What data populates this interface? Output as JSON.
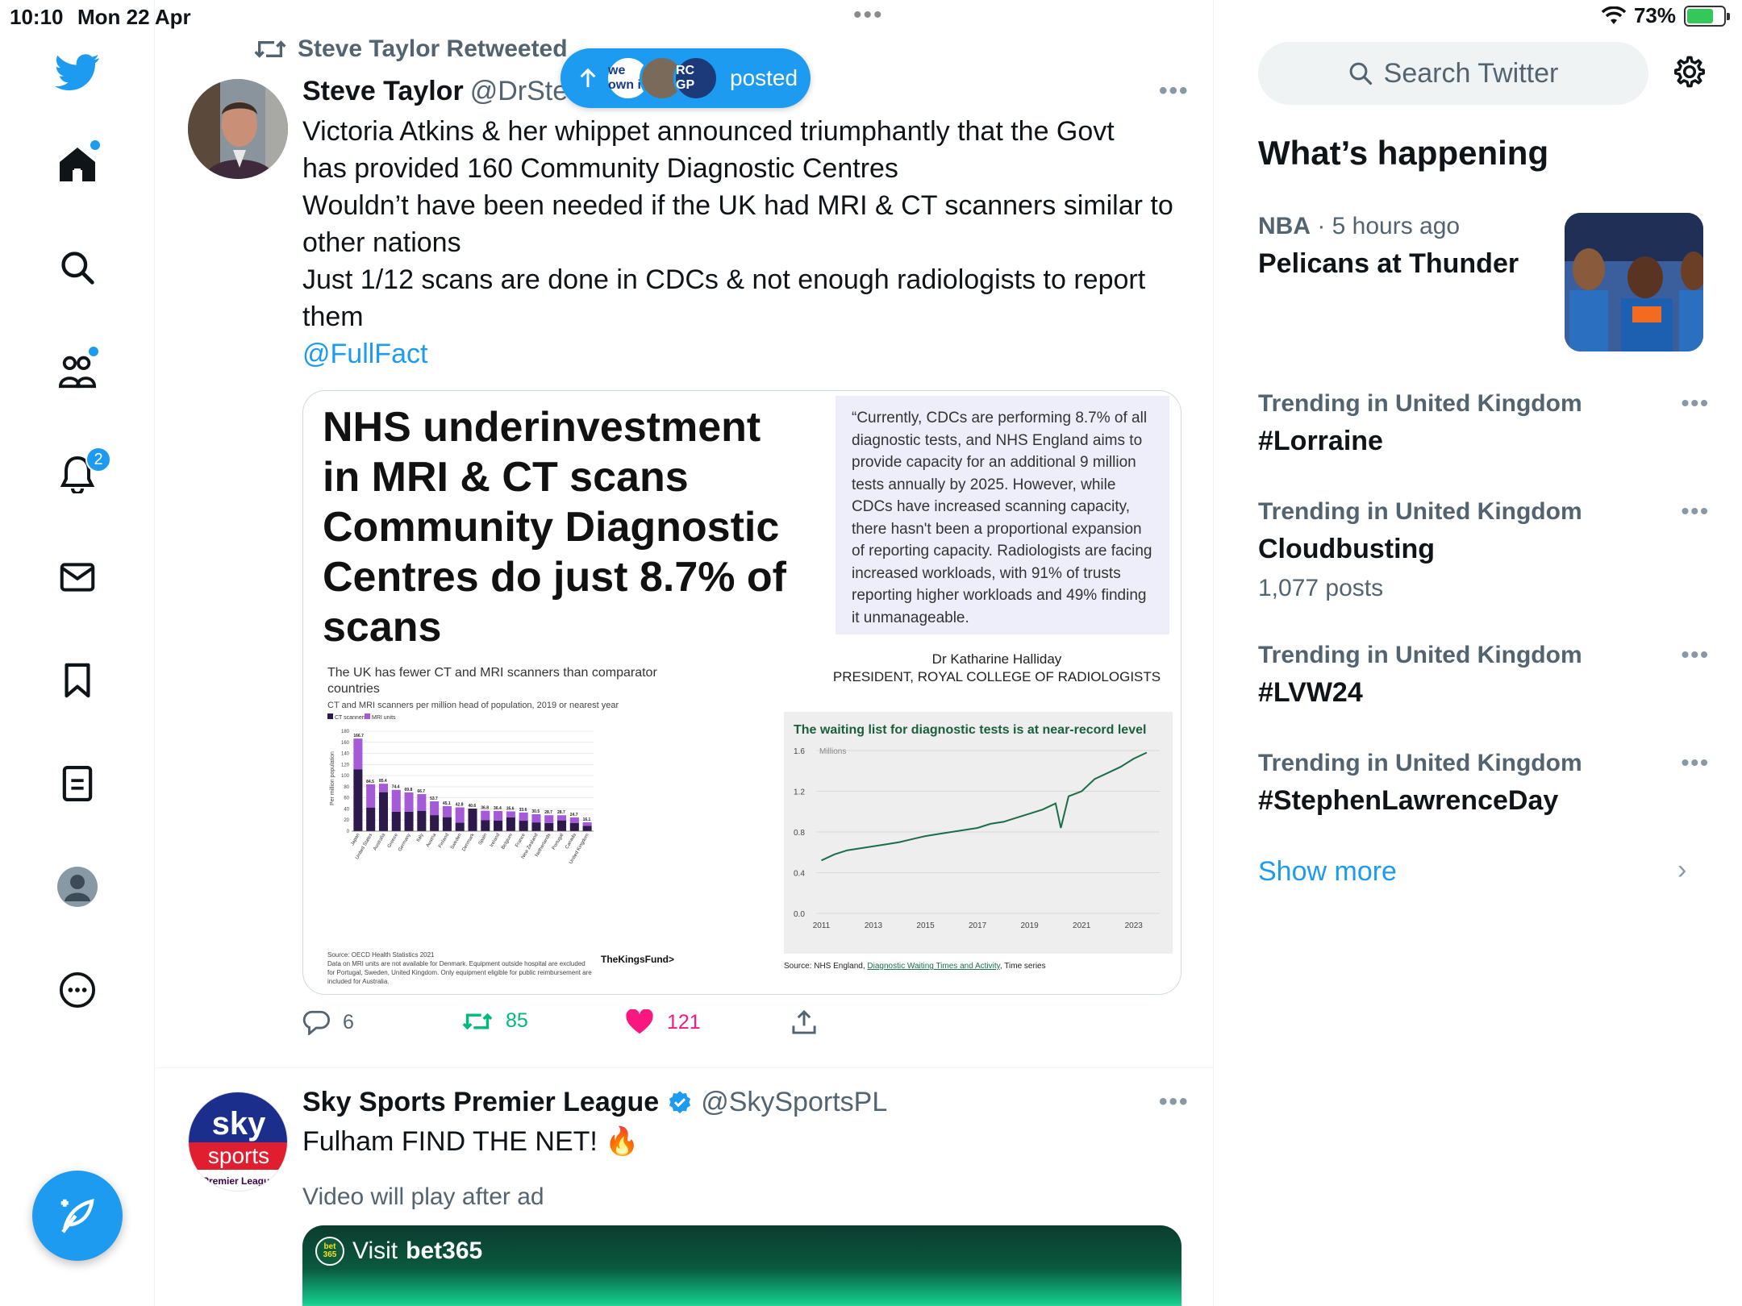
{
  "status_bar": {
    "time": "10:10",
    "date": "Mon 22 Apr",
    "battery": "73%",
    "battery_level": 0.73
  },
  "nav": {
    "notifications_badge": "2",
    "icons": [
      "twitter-logo-icon",
      "home-icon",
      "search-icon",
      "communities-icon",
      "notifications-icon",
      "messages-icon",
      "bookmarks-icon",
      "lists-icon",
      "profile-icon",
      "more-icon"
    ]
  },
  "tweet1": {
    "retweeted_by": "Steve Taylor Retweeted",
    "name": "Steve Taylor",
    "handle": "@DrSte",
    "lines": [
      "Victoria Atkins & her whippet announced triumphantly that the Govt",
      "has provided 160 Community Diagnostic Centres",
      "Wouldn’t have been needed if the UK had MRI & CT scanners similar to",
      "other nations",
      "Just 1/12 scans are done in CDCs & not enough radiologists to report",
      "them"
    ],
    "mention": "@FullFact",
    "posted_pill": {
      "label": "posted",
      "avatar1": "we own it",
      "avatar3": "RC GP"
    },
    "media": {
      "title": "NHS underinvestment in MRI & CT scans Community Diagnostic Centres do just 8.7% of scans",
      "quote": "“Currently, CDCs are performing 8.7% of all diagnostic tests, and NHS England aims to provide capacity for an additional 9 million tests annually by 2025. However, while CDCs have increased scanning capacity, there hasn't been a proportional expansion of reporting capacity. Radiologists are facing increased workloads, with 91% of trusts reporting higher workloads and 49% finding it unmanageable.",
      "attribution_name": "Dr Katharine Halliday",
      "attribution_role": "PRESIDENT, ROYAL COLLEGE OF RADIOLOGISTS",
      "bar_chart_title": "The UK has fewer CT and MRI scanners than comparator countries",
      "bar_chart_subtitle": "CT and MRI scanners per million head of population, 2019 or nearest year",
      "bar_chart_legend_ct": "CT scanners",
      "bar_chart_legend_mri": "MRI units",
      "bar_chart_ylabel": "Per million population",
      "bar_chart_source": "Source: OECD Health Statistics 2021",
      "bar_chart_note": "Data on MRI units are not available for Denmark. Equipment outside hospital are excluded for Portugal, Sweden, United Kingdom. Only equipment eligible for public reimbursement are included for Australia.",
      "bar_chart_brand": "TheKingsFund>",
      "line_chart_title": "The waiting list for diagnostic tests is at near-record level",
      "line_chart_unit": "Millions",
      "line_chart_source_prefix": "Source: NHS England,",
      "line_chart_source_link": "Diagnostic Waiting Times and Activity",
      "line_chart_source_suffix": ", Time series"
    },
    "actions": {
      "replies": "6",
      "retweets": "85",
      "likes": "121"
    }
  },
  "tweet2": {
    "name": "Sky Sports Premier League",
    "handle": "@SkySportsPL",
    "text": "Fulham FIND THE NET! 🔥",
    "subtext": "Video will play after ad",
    "ad_label": "Visit",
    "ad_brand": "bet365",
    "avatar_line1": "sky",
    "avatar_line2": "sports",
    "avatar_line3": "Premier League"
  },
  "sidebar": {
    "search_placeholder": "Search Twitter",
    "whats_happening": "What’s happening",
    "nba": {
      "category": "NBA",
      "time": " · 5 hours ago",
      "title": "Pelicans at Thunder"
    },
    "trends": [
      {
        "context": "Trending in United Kingdom",
        "title": "#Lorraine",
        "posts": ""
      },
      {
        "context": "Trending in United Kingdom",
        "title": "Cloudbusting",
        "posts": "1,077 posts"
      },
      {
        "context": "Trending in United Kingdom",
        "title": "#LVW24",
        "posts": ""
      },
      {
        "context": "Trending in United Kingdom",
        "title": "#StephenLawrenceDay",
        "posts": ""
      }
    ],
    "show_more": "Show more"
  },
  "chart_data": [
    {
      "type": "bar",
      "title": "The UK has fewer CT and MRI scanners than comparator countries",
      "subtitle": "CT and MRI scanners per million head of population, 2019 or nearest year",
      "ylabel": "Per million population",
      "ylim": [
        0,
        180
      ],
      "categories": [
        "Japan",
        "United States",
        "Australia",
        "Greece",
        "Germany",
        "Italy",
        "Austria",
        "Finland",
        "Sweden",
        "Denmark",
        "Spain",
        "Ireland",
        "Belgium",
        "France",
        "New Zealand",
        "Netherlands",
        "Portugal",
        "Canada",
        "United Kingdom"
      ],
      "totals": [
        166.7,
        84.5,
        85.4,
        74.4,
        69.8,
        66.7,
        53.7,
        45.1,
        42.8,
        40.6,
        36.8,
        36.4,
        35.6,
        33.6,
        30.5,
        28.7,
        28.7,
        24.7,
        16.1
      ],
      "series": [
        {
          "name": "CT scanners",
          "values": [
            111.5,
            42.6,
            70.2,
            35.1,
            35.1,
            36.3,
            28.9,
            25.2,
            15.4,
            40.6,
            19.6,
            18.9,
            25.0,
            18.8,
            15.8,
            14.7,
            19.4,
            14.9,
            9.5
          ]
        },
        {
          "name": "MRI units",
          "values": [
            55.2,
            41.9,
            15.2,
            39.3,
            34.7,
            30.4,
            24.8,
            19.9,
            27.4,
            0,
            17.2,
            17.5,
            10.6,
            14.8,
            14.7,
            14.0,
            9.3,
            9.8,
            6.6
          ]
        }
      ]
    },
    {
      "type": "line",
      "title": "The waiting list for diagnostic tests is at near-record level",
      "ylabel": "Millions",
      "ylim": [
        0,
        1.6
      ],
      "yticks": [
        "0.0",
        "0.4",
        "0.8",
        "1.2",
        "1.6"
      ],
      "xticks": [
        "2011",
        "2013",
        "2015",
        "2017",
        "2019",
        "2021",
        "2023"
      ],
      "x": [
        2011.0,
        2011.5,
        2012.0,
        2012.5,
        2013.0,
        2013.5,
        2014.0,
        2014.5,
        2015.0,
        2015.5,
        2016.0,
        2016.5,
        2017.0,
        2017.5,
        2018.0,
        2018.5,
        2019.0,
        2019.5,
        2020.0,
        2020.2,
        2020.5,
        2021.0,
        2021.5,
        2022.0,
        2022.5,
        2023.0,
        2023.5
      ],
      "values": [
        0.52,
        0.58,
        0.62,
        0.64,
        0.66,
        0.68,
        0.7,
        0.73,
        0.76,
        0.78,
        0.8,
        0.82,
        0.84,
        0.88,
        0.9,
        0.94,
        0.98,
        1.02,
        1.08,
        0.84,
        1.15,
        1.2,
        1.32,
        1.38,
        1.44,
        1.52,
        1.58
      ]
    }
  ]
}
